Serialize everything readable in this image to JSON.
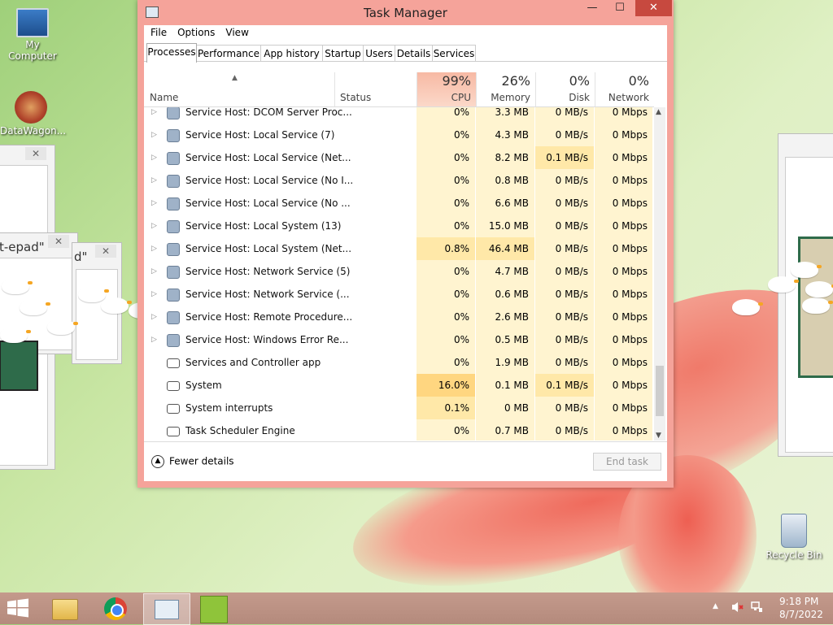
{
  "desktop": {
    "icons": [
      {
        "label": "My Computer"
      },
      {
        "label": "DataWagon..."
      },
      {
        "label": "Recycle Bin"
      }
    ],
    "stray_windows": [
      {
        "title": "t-epad\"",
        "close": "✕"
      },
      {
        "title": "d\"",
        "close": "✕"
      },
      {
        "close": "✕"
      }
    ]
  },
  "window": {
    "title": "Task Manager",
    "controls": {
      "minimize": "—",
      "maximize": "☐",
      "close": "✕"
    },
    "menu": [
      "File",
      "Options",
      "View"
    ],
    "tabs": [
      "Processes",
      "Performance",
      "App history",
      "Startup",
      "Users",
      "Details",
      "Services"
    ],
    "active_tab": "Processes",
    "columns": {
      "name": "Name",
      "status": "Status",
      "cpu": {
        "percent": "99%",
        "label": "CPU"
      },
      "memory": {
        "percent": "26%",
        "label": "Memory"
      },
      "disk": {
        "percent": "0%",
        "label": "Disk"
      },
      "network": {
        "percent": "0%",
        "label": "Network"
      }
    },
    "rows": [
      {
        "name": "Service Host: DCOM Server Proc...",
        "cpu": "0%",
        "memory": "3.3 MB",
        "disk": "0 MB/s",
        "network": "0 Mbps"
      },
      {
        "name": "Service Host: Local Service (7)",
        "cpu": "0%",
        "memory": "4.3 MB",
        "disk": "0 MB/s",
        "network": "0 Mbps"
      },
      {
        "name": "Service Host: Local Service (Net...",
        "cpu": "0%",
        "memory": "8.2 MB",
        "disk": "0.1 MB/s",
        "network": "0 Mbps"
      },
      {
        "name": "Service Host: Local Service (No I...",
        "cpu": "0%",
        "memory": "0.8 MB",
        "disk": "0 MB/s",
        "network": "0 Mbps"
      },
      {
        "name": "Service Host: Local Service (No ...",
        "cpu": "0%",
        "memory": "6.6 MB",
        "disk": "0 MB/s",
        "network": "0 Mbps"
      },
      {
        "name": "Service Host: Local System (13)",
        "cpu": "0%",
        "memory": "15.0 MB",
        "disk": "0 MB/s",
        "network": "0 Mbps"
      },
      {
        "name": "Service Host: Local System (Net...",
        "cpu": "0.8%",
        "memory": "46.4 MB",
        "disk": "0 MB/s",
        "network": "0 Mbps"
      },
      {
        "name": "Service Host: Network Service (5)",
        "cpu": "0%",
        "memory": "4.7 MB",
        "disk": "0 MB/s",
        "network": "0 Mbps"
      },
      {
        "name": "Service Host: Network Service (...",
        "cpu": "0%",
        "memory": "0.6 MB",
        "disk": "0 MB/s",
        "network": "0 Mbps"
      },
      {
        "name": "Service Host: Remote Procedure...",
        "cpu": "0%",
        "memory": "2.6 MB",
        "disk": "0 MB/s",
        "network": "0 Mbps"
      },
      {
        "name": "Service Host: Windows Error Re...",
        "cpu": "0%",
        "memory": "0.5 MB",
        "disk": "0 MB/s",
        "network": "0 Mbps"
      },
      {
        "name": "Services and Controller app",
        "cpu": "0%",
        "memory": "1.9 MB",
        "disk": "0 MB/s",
        "network": "0 Mbps"
      },
      {
        "name": "System",
        "cpu": "16.0%",
        "memory": "0.1 MB",
        "disk": "0.1 MB/s",
        "network": "0 Mbps"
      },
      {
        "name": "System interrupts",
        "cpu": "0.1%",
        "memory": "0 MB",
        "disk": "0 MB/s",
        "network": "0 Mbps"
      },
      {
        "name": "Task Scheduler Engine",
        "cpu": "0%",
        "memory": "0.7 MB",
        "disk": "0 MB/s",
        "network": "0 Mbps"
      }
    ],
    "footer": {
      "fewer_details": "Fewer details",
      "end_task": "End task"
    }
  },
  "taskbar": {
    "start_icon": "windows-logo-icon",
    "time": "9:18 PM",
    "date": "8/7/2022"
  },
  "colors": {
    "window_frame": "#f5a39a",
    "close_button": "#c7493f",
    "cpu_header_highlight": "#f9c6b2",
    "heat_light": "#fff4d0",
    "heat_mid": "#ffe8a8",
    "heat_strong": "#ffd680",
    "taskbar": "#b48a7c"
  }
}
